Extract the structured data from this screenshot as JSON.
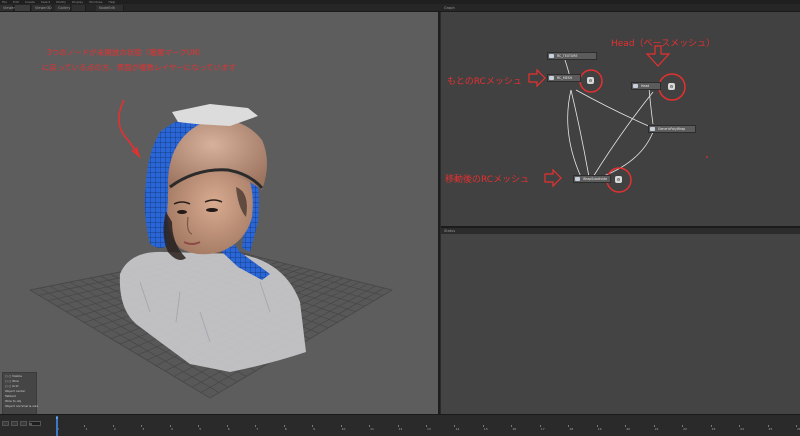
{
  "menu": {
    "items": [
      "File",
      "Edit",
      "Create",
      "Select",
      "Modify",
      "Display",
      "Windows",
      "Help"
    ]
  },
  "tabs": [
    {
      "label": "ViewerIO"
    },
    {
      "label": "",
      "active": true
    },
    {
      "label": "Viewer3D"
    },
    {
      "label": "Gallery"
    },
    {
      "label": ""
    },
    {
      "label": "NodeEdit"
    }
  ],
  "graph": {
    "title": "Graph",
    "nodes": [
      {
        "label": "RC_TEXTURE"
      },
      {
        "label": "RC_MESH"
      },
      {
        "label": "Head"
      },
      {
        "label": "GenericPolyWrap"
      },
      {
        "label": "WrapSubdivide"
      }
    ],
    "badge_symbol": "⚙"
  },
  "annotations": {
    "viewport_note_line1": "3つのノードが未開放の状態（階層マークUN）",
    "viewport_note_line2": "に戻っている点の方、表面が複数レイヤーになっています",
    "rc_mesh_label": "もとのRCメッシュ",
    "head_label": "Head（ベースメッシュ）",
    "moved_mesh_label": "移動後のRCメッシュ"
  },
  "lower_panel": {
    "title": "Status"
  },
  "hud": {
    "lines": [
      "○ ○ Visible",
      "○ ○ Wire",
      "○ ○ Grid",
      "Object center",
      "Tabbed",
      "Wire to obj",
      "Object nornmal & size"
    ]
  },
  "timeline": {
    "current_frame": "0",
    "ticks": [
      "0",
      "1",
      "2",
      "3",
      "4",
      "5",
      "6",
      "7",
      "8",
      "9",
      "10",
      "11",
      "12",
      "13",
      "14",
      "15",
      "16",
      "17",
      "18",
      "19",
      "20",
      "21",
      "22",
      "23",
      "24",
      "25",
      "26"
    ]
  },
  "colors": {
    "annotation_red": "#e53030",
    "viewport_bg": "#5d5d5d",
    "graph_bg": "#414141",
    "wire_blue": "#2a66d6",
    "skin": "#c99a80"
  }
}
